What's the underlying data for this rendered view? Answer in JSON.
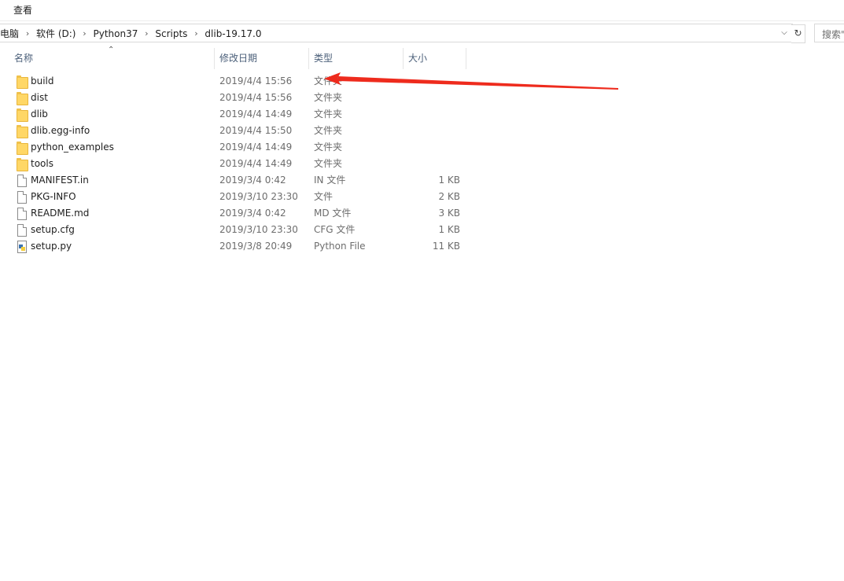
{
  "ribbon": {
    "view_tab": "查看"
  },
  "address": {
    "crumbs": [
      "电脑",
      "软件 (D:)",
      "Python37",
      "Scripts",
      "dlib-19.17.0"
    ],
    "search_placeholder": "搜索\""
  },
  "columns": {
    "name": "名称",
    "date": "修改日期",
    "type": "类型",
    "size": "大小"
  },
  "files": [
    {
      "name": "build",
      "date": "2019/4/4 15:56",
      "type": "文件夹",
      "size": "",
      "icon": "folder-icon"
    },
    {
      "name": "dist",
      "date": "2019/4/4 15:56",
      "type": "文件夹",
      "size": "",
      "icon": "folder-icon"
    },
    {
      "name": "dlib",
      "date": "2019/4/4 14:49",
      "type": "文件夹",
      "size": "",
      "icon": "folder-icon"
    },
    {
      "name": "dlib.egg-info",
      "date": "2019/4/4 15:50",
      "type": "文件夹",
      "size": "",
      "icon": "folder-icon"
    },
    {
      "name": "python_examples",
      "date": "2019/4/4 14:49",
      "type": "文件夹",
      "size": "",
      "icon": "folder-icon"
    },
    {
      "name": "tools",
      "date": "2019/4/4 14:49",
      "type": "文件夹",
      "size": "",
      "icon": "folder-icon"
    },
    {
      "name": "MANIFEST.in",
      "date": "2019/3/4 0:42",
      "type": "IN 文件",
      "size": "1 KB",
      "icon": "file-icon"
    },
    {
      "name": "PKG-INFO",
      "date": "2019/3/10 23:30",
      "type": "文件",
      "size": "2 KB",
      "icon": "file-icon"
    },
    {
      "name": "README.md",
      "date": "2019/3/4 0:42",
      "type": "MD 文件",
      "size": "3 KB",
      "icon": "file-icon"
    },
    {
      "name": "setup.cfg",
      "date": "2019/3/10 23:30",
      "type": "CFG 文件",
      "size": "1 KB",
      "icon": "file-icon"
    },
    {
      "name": "setup.py",
      "date": "2019/3/8 20:49",
      "type": "Python File",
      "size": "11 KB",
      "icon": "python-file-icon"
    }
  ],
  "colors": {
    "header_text": "#4c607a",
    "folder_fill": "#ffd766",
    "arrow": "#ee2b1d"
  }
}
